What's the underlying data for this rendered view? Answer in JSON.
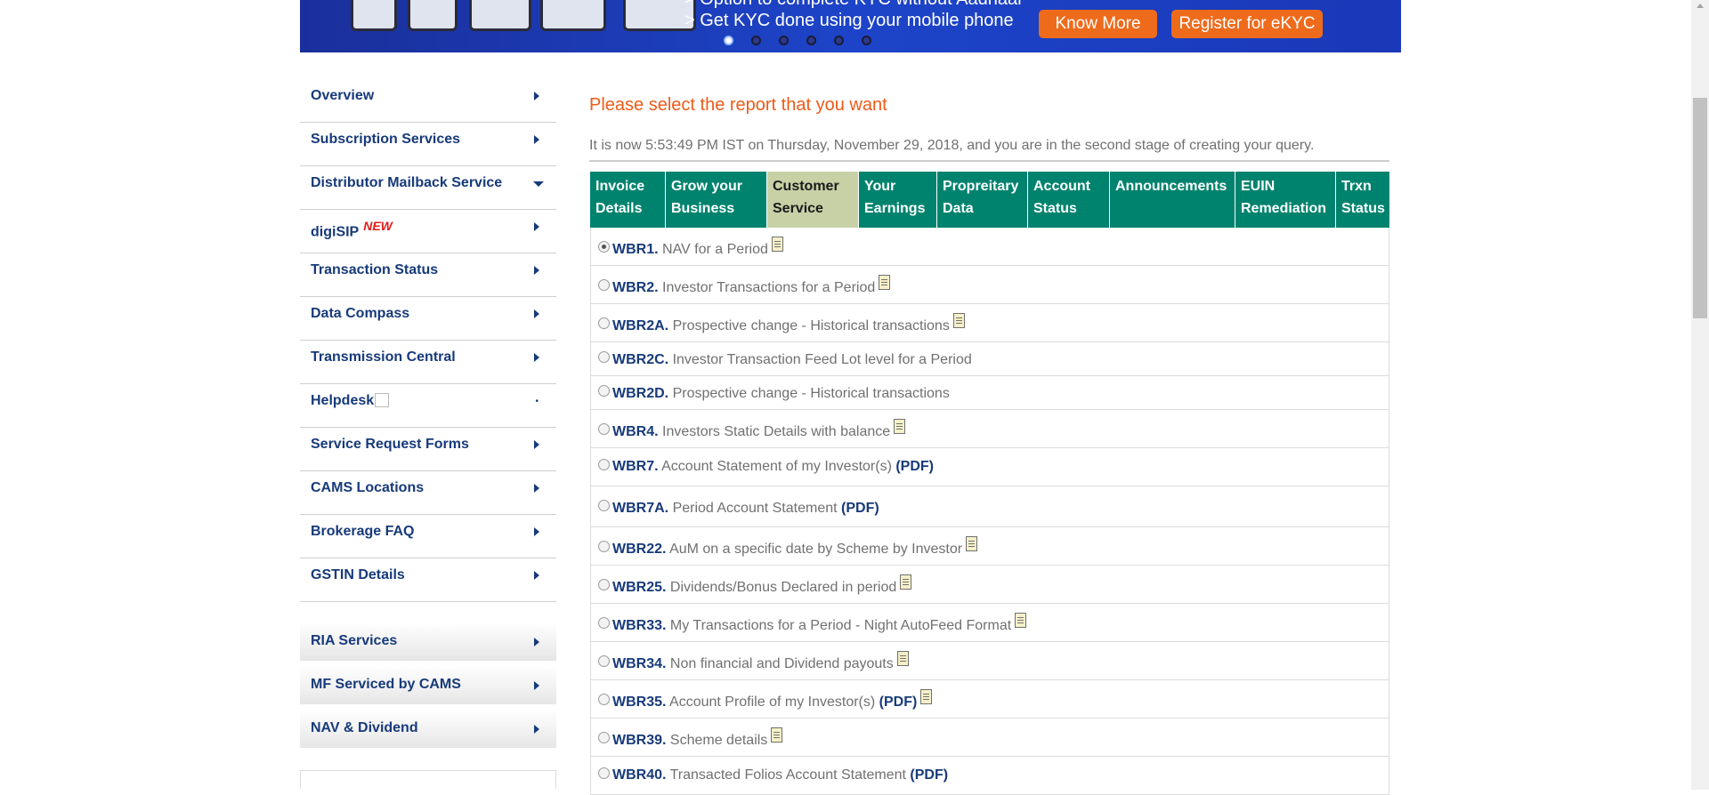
{
  "banner": {
    "line1": "> Option to complete KYC without Aadhaar",
    "line2": "> Get KYC done using your mobile phone",
    "know_more_label": "Know More",
    "register_label": "Register for eKYC",
    "slide_count": 6,
    "active_slide": 1
  },
  "sidebar": {
    "items": [
      {
        "label": "Overview",
        "indicator": "chevron-right-icon"
      },
      {
        "label": "Subscription Services",
        "indicator": "chevron-right-icon"
      },
      {
        "label": "Distributor Mailback Service",
        "indicator": "chevron-down-icon"
      },
      {
        "label": "digiSIP",
        "badge": "NEW",
        "indicator": "chevron-right-icon"
      },
      {
        "label": "Transaction Status",
        "indicator": "chevron-right-icon"
      },
      {
        "label": "Data Compass",
        "indicator": "chevron-right-icon"
      },
      {
        "label": "Transmission Central",
        "indicator": "chevron-right-icon"
      },
      {
        "label": "Helpdesk",
        "icon": "broken-image-icon",
        "indicator": "small-chevron-icon"
      },
      {
        "label": "Service Request Forms",
        "indicator": "chevron-right-icon"
      },
      {
        "label": "CAMS Locations",
        "indicator": "chevron-right-icon"
      },
      {
        "label": "Brokerage FAQ",
        "indicator": "chevron-right-icon"
      },
      {
        "label": "GSTIN Details",
        "indicator": "chevron-right-icon"
      }
    ],
    "groups": [
      {
        "label": "RIA Services"
      },
      {
        "label": "MF Serviced by CAMS"
      },
      {
        "label": "NAV & Dividend"
      }
    ]
  },
  "main": {
    "heading": "Please select the report that you want",
    "status_line": "It is now 5:53:49 PM IST on Thursday, November 29, 2018, and you are in the second stage of creating your query.",
    "tabs": [
      {
        "line1": "Invoice",
        "line2": "Details"
      },
      {
        "line1": "Grow your",
        "line2": "Business"
      },
      {
        "line1": "Customer",
        "line2": "Service",
        "active": true
      },
      {
        "line1": "Your",
        "line2": "Earnings"
      },
      {
        "line1": "Propreitary",
        "line2": "Data"
      },
      {
        "line1": "Account",
        "line2": "Status"
      },
      {
        "line1": "Announcements",
        "line2": ""
      },
      {
        "line1": "EUIN",
        "line2": "Remediation"
      },
      {
        "line1": "Trxn",
        "line2": "Status"
      }
    ],
    "reports": [
      {
        "code": "WBR1.",
        "desc": "NAV for a Period",
        "pdf": "",
        "sample_icon": true,
        "selected": true
      },
      {
        "code": "WBR2.",
        "desc": "Investor Transactions for a Period",
        "pdf": "",
        "sample_icon": true
      },
      {
        "code": "WBR2A.",
        "desc": "Prospective change - Historical transactions",
        "pdf": "",
        "sample_icon": true
      },
      {
        "code": "WBR2C.",
        "desc": "Investor Transaction Feed Lot level for a Period",
        "pdf": "",
        "sample_icon": false
      },
      {
        "code": "WBR2D.",
        "desc": "Prospective change - Historical transactions",
        "pdf": "",
        "sample_icon": false
      },
      {
        "code": "WBR4.",
        "desc": "Investors Static Details with balance",
        "pdf": "",
        "sample_icon": true
      },
      {
        "code": "WBR7.",
        "desc": "Account Statement of my Investor(s)",
        "pdf": "(PDF)",
        "sample_icon": false
      },
      {
        "code": "WBR7A.",
        "desc": "Period Account Statement",
        "pdf": "(PDF)",
        "sample_icon": false
      },
      {
        "code": "WBR22.",
        "desc": "AuM on a specific date by Scheme by Investor",
        "pdf": "",
        "sample_icon": true
      },
      {
        "code": "WBR25.",
        "desc": "Dividends/Bonus Declared in period",
        "pdf": "",
        "sample_icon": true
      },
      {
        "code": "WBR33.",
        "desc": "My Transactions for a Period - Night AutoFeed Format",
        "pdf": "",
        "sample_icon": true
      },
      {
        "code": "WBR34.",
        "desc": "Non financial and Dividend payouts",
        "pdf": "",
        "sample_icon": true
      },
      {
        "code": "WBR35.",
        "desc": "Account Profile of my Investor(s)",
        "pdf": "(PDF)",
        "sample_icon": true
      },
      {
        "code": "WBR39.",
        "desc": "Scheme details",
        "pdf": "",
        "sample_icon": true
      },
      {
        "code": "WBR40.",
        "desc": "Transacted Folios Account Statement",
        "pdf": "(PDF)",
        "sample_icon": false
      }
    ]
  }
}
